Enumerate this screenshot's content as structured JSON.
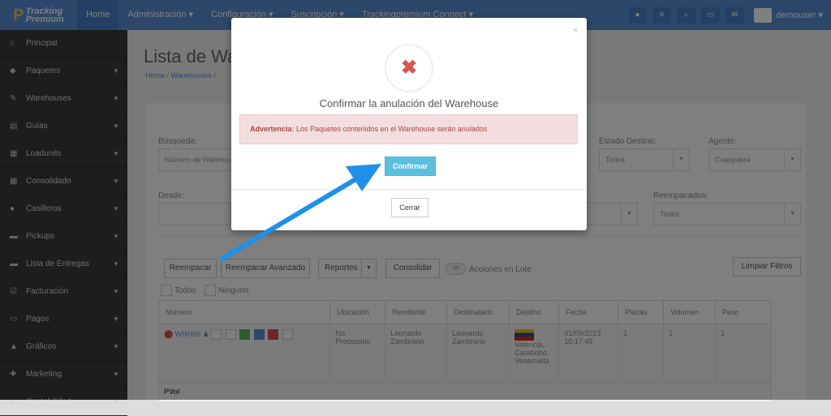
{
  "logo": {
    "line1": "Tracking",
    "line2": "Premium"
  },
  "nav": [
    "Home",
    "Administración ▾",
    "Configuración ▾",
    "Suscripción ▾",
    "Trackingpremium Connect ▾"
  ],
  "user": {
    "name": "demouser ▾",
    "avatar": "logo"
  },
  "sidebar": [
    {
      "label": "Principal",
      "icon": "home-icon",
      "glyph": "⌂",
      "caret": false
    },
    {
      "label": "Paquetes",
      "icon": "tag-icon",
      "glyph": "◆",
      "caret": true
    },
    {
      "label": "Warehouses",
      "icon": "edit-icon",
      "glyph": "✎",
      "caret": true
    },
    {
      "label": "Guías",
      "icon": "list-icon",
      "glyph": "▤",
      "caret": true
    },
    {
      "label": "Loadunits",
      "icon": "cube-icon",
      "glyph": "▦",
      "caret": true
    },
    {
      "label": "Consolidado",
      "icon": "table-icon",
      "glyph": "▦",
      "caret": true
    },
    {
      "label": "Casilleros",
      "icon": "marker-icon",
      "glyph": "●",
      "caret": true
    },
    {
      "label": "Pickups",
      "icon": "car-icon",
      "glyph": "▬",
      "caret": true
    },
    {
      "label": "Lista de Entregas",
      "icon": "truck-icon",
      "glyph": "▬",
      "caret": true
    },
    {
      "label": "Facturación",
      "icon": "check-icon",
      "glyph": "☑",
      "caret": true
    },
    {
      "label": "Pagos",
      "icon": "money-icon",
      "glyph": "▭",
      "caret": true
    },
    {
      "label": "Gráficos",
      "icon": "chart-icon",
      "glyph": "▲",
      "caret": true
    },
    {
      "label": "Marketing",
      "icon": "user-plus-icon",
      "glyph": "✚",
      "caret": true
    },
    {
      "label": "Contabilidad",
      "icon": "bank-icon",
      "glyph": "⌂",
      "caret": true
    }
  ],
  "page": {
    "title": "Lista de Wa",
    "crumb_home": "Home",
    "crumb_sep": "/",
    "crumb_link": "Warehouses",
    "crumb_sep2": "/"
  },
  "filters": {
    "busqueda_label": "Búsqueda:",
    "busqueda_placeholder": "Número de Warehou",
    "estado_label": "Estado Destino:",
    "estado_value": "Todos",
    "agente_label": "Agente:",
    "agente_value": "Cualquiera",
    "desde_label": "Desde:",
    "reempacados_label": "Reempacados:",
    "reempacados_value": "Todos"
  },
  "toolbar": {
    "reempacar": "Reempacar",
    "reempacar_avanzado": "Reempacar Avanzado",
    "reportes": "Reportes",
    "consolidar": "Consolidar",
    "toggle": "Off",
    "acciones": "Acciones en Lote",
    "limpiar": "Limpiar Filtros",
    "todos": "Todos",
    "ninguno": "Ninguno"
  },
  "table": {
    "headers": [
      "Número",
      "Ubicación",
      "Remitente",
      "Destinatario",
      "Destino",
      "Fecha",
      "Piezas",
      "Volumen",
      "Peso"
    ],
    "row": {
      "numero": "WRH65",
      "ubicacion": "No Procesado",
      "remitente": "Leonardo Zambrano",
      "destinatario": "Leonardo Zambrano",
      "destino": "Valencia, Carabobo, Venezuela",
      "fecha": "01/09/2023 10:17:49",
      "piezas": "1",
      "volumen": "1",
      "peso": "1"
    },
    "footer": "PVol"
  },
  "modal": {
    "close": "×",
    "title": "Confirmar la anulación del Warehouse",
    "warning_bold": "Advertencia:",
    "warning_text": " Los Paquetes contenidos en el Warehouse serán anulados",
    "confirm": "Confirmar",
    "cerrar": "Cerrar"
  },
  "colors": {
    "topbar": "#5b8fd6",
    "sidebar": "#3a3a3a",
    "confirm": "#5bc0de",
    "danger": "#d9534f",
    "arrow": "#1e90e8"
  }
}
